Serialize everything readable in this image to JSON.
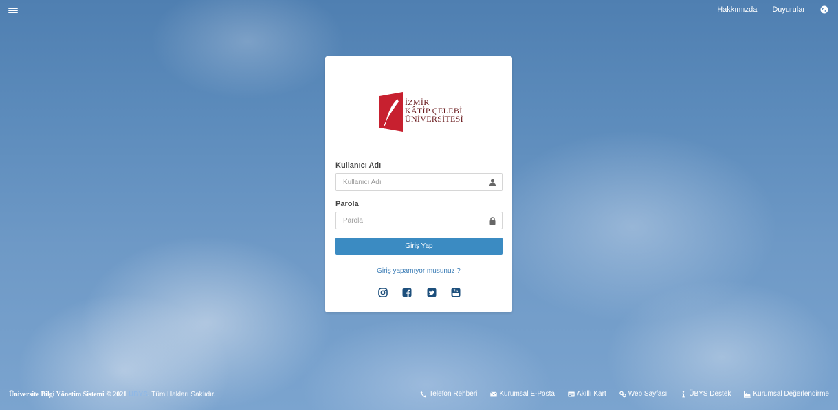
{
  "topbar": {
    "menu_icon": "hamburger-menu-icon",
    "links": [
      {
        "label": "Hakkımızda"
      },
      {
        "label": "Duyurular"
      }
    ],
    "language_icon": "globe-icon"
  },
  "login": {
    "logo": {
      "line1": "İZMİR",
      "line2": "KÂTİP ÇELEBİ",
      "line3": "ÜNİVERSİTESİ",
      "colors": {
        "red": "#c7202f",
        "dark": "#6b1b1e"
      }
    },
    "username": {
      "label": "Kullanıcı Adı",
      "placeholder": "Kullanıcı Adı",
      "value": "",
      "icon": "user-icon"
    },
    "password": {
      "label": "Parola",
      "placeholder": "Parola",
      "value": "",
      "icon": "lock-icon"
    },
    "submit_label": "Giriş Yap",
    "help_link": "Giriş yapamıyor musunuz ?",
    "socials": [
      {
        "icon": "instagram-icon"
      },
      {
        "icon": "facebook-icon"
      },
      {
        "icon": "twitter-icon"
      },
      {
        "icon": "youtube-icon"
      }
    ],
    "accent_color": "#3b8bc2"
  },
  "footer": {
    "system_name": "Üniversite Bilgi Yönetim Sistemi © 2021",
    "brand": "UBYS",
    "rights": ". Tüm Hakları Saklıdır.",
    "links": [
      {
        "label": "Telefon Rehberi",
        "icon": "phone-icon"
      },
      {
        "label": "Kurumsal E-Posta",
        "icon": "envelope-icon"
      },
      {
        "label": "Akıllı Kart",
        "icon": "id-card-icon"
      },
      {
        "label": "Web Sayfası",
        "icon": "link-icon"
      },
      {
        "label": "ÜBYS Destek",
        "icon": "info-icon"
      },
      {
        "label": "Kurumsal Değerlendirme",
        "icon": "area-chart-icon"
      }
    ]
  }
}
